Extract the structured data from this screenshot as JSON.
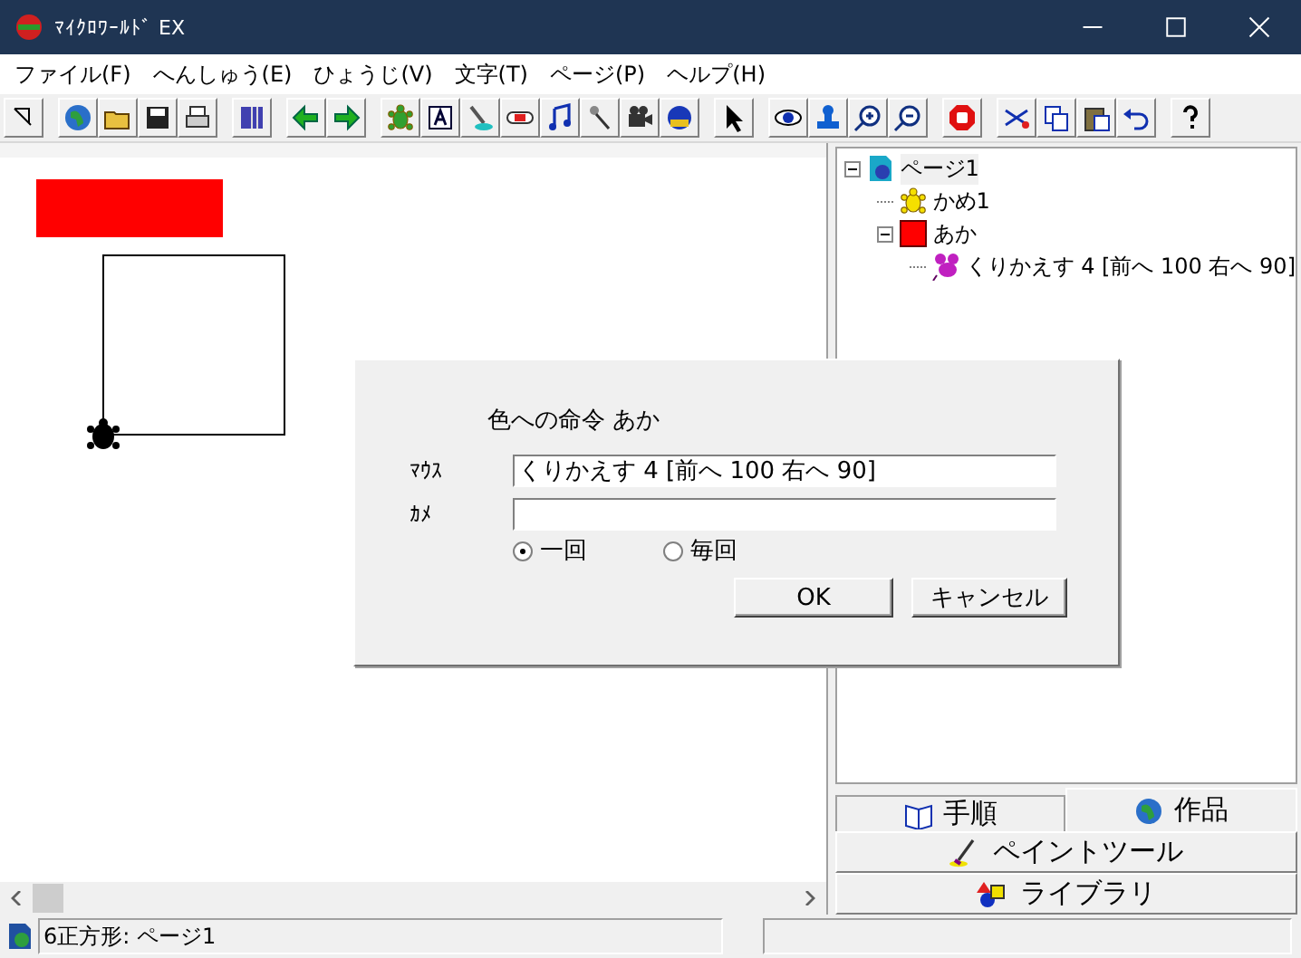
{
  "window": {
    "title": "ﾏｲｸﾛﾜｰﾙﾄﾞ EX"
  },
  "menu": [
    "ファイル(F)",
    "へんしゅう(E)",
    "ひょうじ(V)",
    "文字(T)",
    "ページ(P)",
    "ヘルプ(H)"
  ],
  "tree": [
    {
      "kind": "page",
      "label": "ページ1",
      "selected": true,
      "expanded": true,
      "children": [
        {
          "kind": "turtle",
          "label": "かめ1",
          "selected": false
        },
        {
          "kind": "color",
          "label": "あか",
          "selected": false,
          "expanded": true,
          "children": [
            {
              "kind": "procedure",
              "label": "くりかえす 4 [前へ 100 右へ 90]",
              "selected": false
            }
          ]
        }
      ]
    }
  ],
  "panel_tabs": [
    {
      "label": "手順",
      "selected": false
    },
    {
      "label": "作品",
      "selected": true
    }
  ],
  "panel_buttons": [
    "ペイントツール",
    "ライブラリ"
  ],
  "dialog": {
    "title": "色への命令  あか",
    "fields": [
      {
        "label": "ﾏｳｽ",
        "value": "くりかえす 4 [前へ 100 右へ 90]"
      },
      {
        "label": "ｶﾒ"
      }
    ],
    "options": [
      {
        "label": "一回",
        "selected": true
      },
      {
        "label": "毎回",
        "selected": false
      }
    ],
    "buttons": [
      "OK",
      "キャンセル"
    ]
  },
  "status_bar": {
    "text": "6正方形: ページ1"
  }
}
